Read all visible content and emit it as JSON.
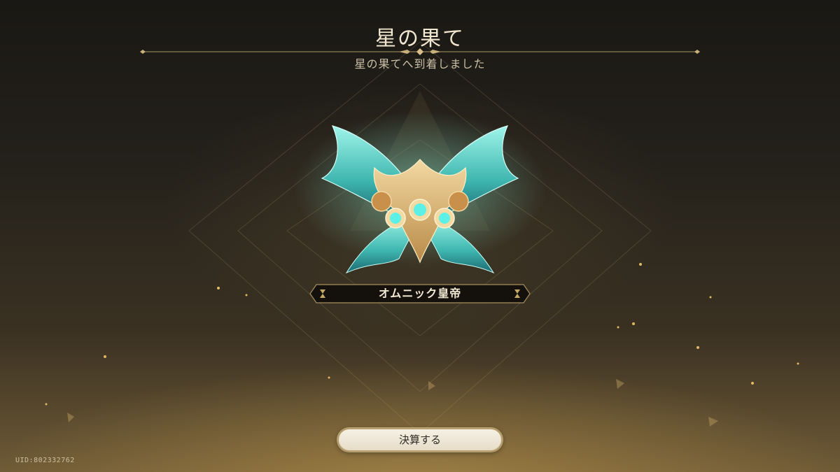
{
  "header": {
    "title": "星の果て",
    "subtitle": "星の果てへ到着しました"
  },
  "emblem": {
    "icon": "butterfly-emblem-icon",
    "name": "オムニック皇帝"
  },
  "actions": {
    "settle_label": "決算する"
  },
  "footer": {
    "uid": "UID:802332762"
  },
  "colors": {
    "accent_gold": "#c9a96a",
    "wing_cyan": "#6fe3d8",
    "button_bg": "#f2ece0"
  }
}
